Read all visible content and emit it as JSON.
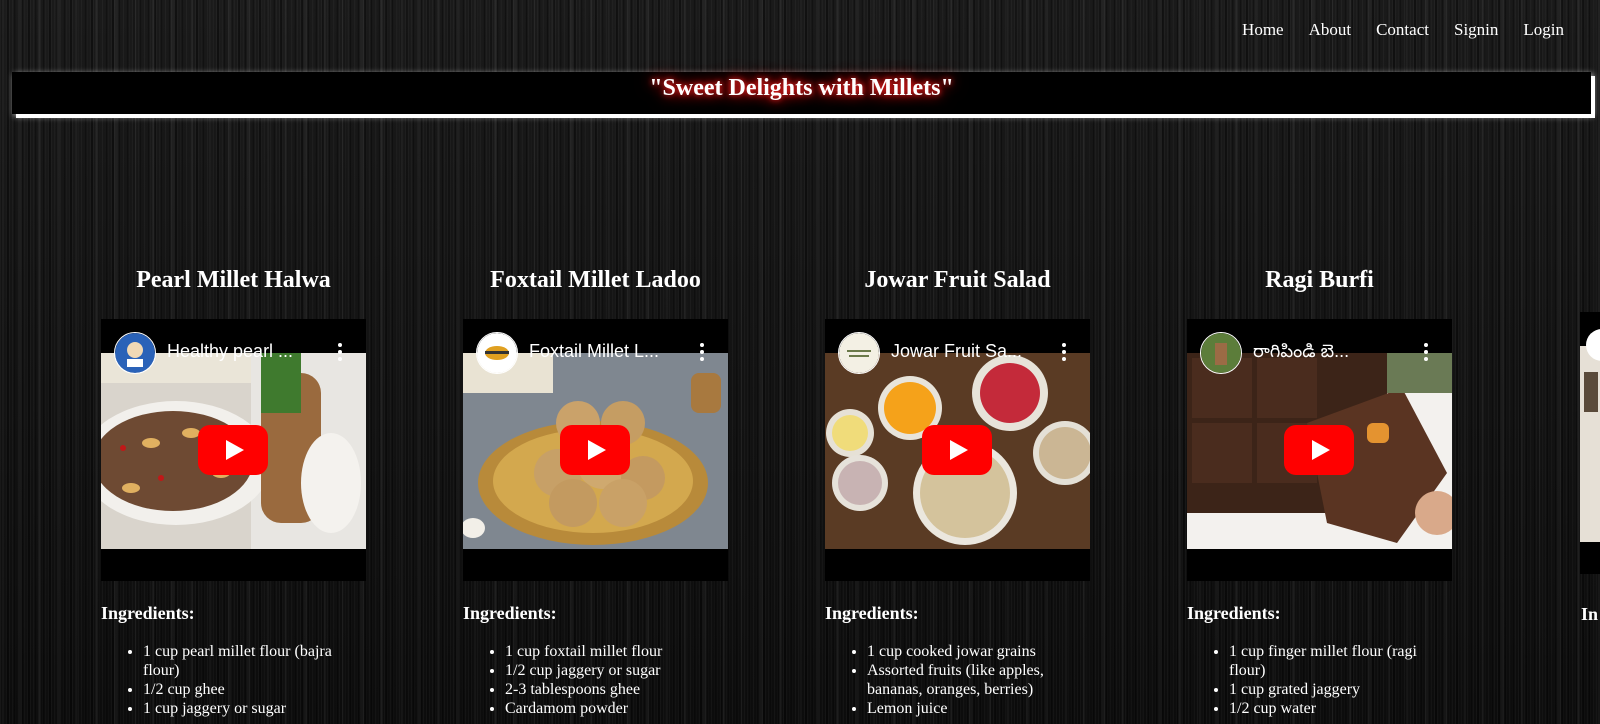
{
  "nav": {
    "items": [
      "Home",
      "About",
      "Contact",
      "Signin",
      "Login"
    ]
  },
  "banner": {
    "title": "\"Sweet Delights with Millets\""
  },
  "cards": [
    {
      "title": "Pearl Millet Halwa",
      "video_title": "Healthy pearl ...",
      "ingredients_heading": "Ingredients:",
      "ingredients": [
        "1 cup pearl millet flour (bajra flour)",
        "1/2 cup ghee",
        "1 cup jaggery or sugar"
      ]
    },
    {
      "title": "Foxtail Millet Ladoo",
      "video_title": "Foxtail Millet L...",
      "ingredients_heading": "Ingredients:",
      "ingredients": [
        "1 cup foxtail millet flour",
        "1/2 cup jaggery or sugar",
        "2-3 tablespoons ghee",
        "Cardamom powder"
      ]
    },
    {
      "title": "Jowar Fruit Salad",
      "video_title": "Jowar Fruit Sa...",
      "ingredients_heading": "Ingredients:",
      "ingredients": [
        "1 cup cooked jowar grains",
        "Assorted fruits (like apples, bananas, oranges, berries)",
        "Lemon juice"
      ]
    },
    {
      "title": "Ragi Burfi",
      "video_title": "రాగిపిండి బె...",
      "ingredients_heading": "Ingredients:",
      "ingredients": [
        "1 cup finger millet flour (ragi flour)",
        "1 cup grated jaggery",
        "1/2 cup water"
      ]
    }
  ],
  "peek_card": {
    "ingredients_heading": "In"
  },
  "colors": {
    "banner_glow": "#c00000",
    "play_button": "#ff0000"
  }
}
